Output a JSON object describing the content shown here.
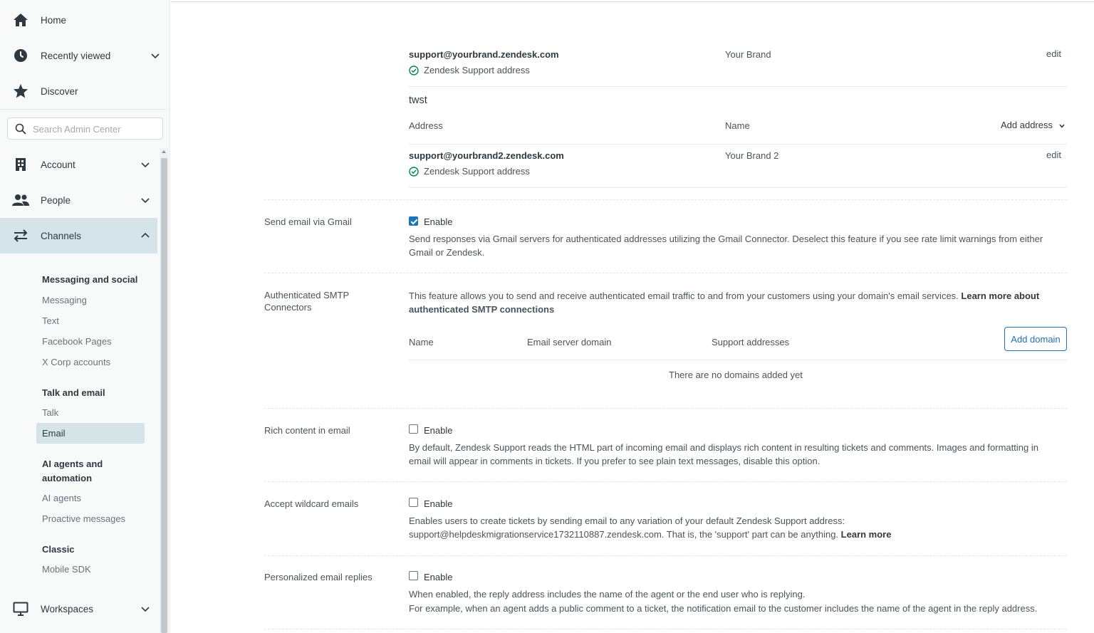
{
  "sidebar": {
    "top_items": [
      {
        "label": "Home",
        "icon": "home-icon"
      },
      {
        "label": "Recently viewed",
        "icon": "clock-icon"
      },
      {
        "label": "Discover",
        "icon": "star-icon"
      }
    ],
    "search_placeholder": "Search Admin Center",
    "sections": [
      {
        "label": "Account",
        "icon": "building-icon"
      },
      {
        "label": "People",
        "icon": "people-icon"
      },
      {
        "label": "Channels",
        "icon": "arrows-icon"
      },
      {
        "label": "Workspaces",
        "icon": "monitor-icon"
      }
    ],
    "channels_groups": [
      {
        "heading": "Messaging and social",
        "items": [
          "Messaging",
          "Text",
          "Facebook Pages",
          "X Corp accounts"
        ]
      },
      {
        "heading": "Talk and email",
        "items": [
          "Talk",
          "Email"
        ]
      },
      {
        "heading": "AI agents and automation",
        "items": [
          "AI agents",
          "Proactive messages"
        ]
      },
      {
        "heading": "Classic",
        "items": [
          "Mobile SDK"
        ]
      }
    ],
    "selected_item": "Email"
  },
  "addresses": {
    "row1": {
      "address": "support@yourbrand.zendesk.com",
      "subtitle": "Zendesk Support address",
      "name": "Your Brand",
      "action": "edit"
    },
    "brand_heading": "twst",
    "col_address": "Address",
    "col_name": "Name",
    "add_address": "Add address",
    "row2": {
      "address": "support@yourbrand2.zendesk.com",
      "subtitle": "Zendesk Support address",
      "name": "Your Brand 2",
      "action": "edit"
    }
  },
  "settings": {
    "gmail": {
      "label": "Send email via Gmail",
      "enable": "Enable",
      "checked": true,
      "desc_line1": "Send responses via Gmail servers for authenticated addresses utilizing the Gmail Connector. Deselect this feature if you see rate limit warnings from either",
      "desc_line2": "Gmail or Zendesk."
    },
    "smtp": {
      "label_line1": "Authenticated SMTP",
      "label_line2": "Connectors",
      "desc_line1": "This feature allows you to send and receive authenticated email traffic to and from your customers using your domain's email services.",
      "learn_more_1": "Learn more about",
      "learn_more_2": "authenticated SMTP connections",
      "col_name": "Name",
      "col_domain": "Email server domain",
      "col_support": "Support addresses",
      "add_domain": "Add domain",
      "empty": "There are no domains added yet"
    },
    "rich": {
      "label": "Rich content in email",
      "enable": "Enable",
      "checked": false,
      "desc_line1": "By default, Zendesk Support reads the HTML part of incoming email and displays rich content in resulting tickets and comments. Images and formatting in",
      "desc_line2": "email will appear in comments in tickets. If you prefer to see plain text messages, disable this option."
    },
    "wildcard": {
      "label": "Accept wildcard emails",
      "enable": "Enable",
      "checked": false,
      "desc_line1": "Enables users to create tickets by sending email to any variation of your default Zendesk Support address:",
      "desc_line2": "support@helpdeskmigrationservice1732110887.zendesk.com. That is, the 'support' part can be anything.",
      "learn_more": "Learn more"
    },
    "personalized": {
      "label": "Personalized email replies",
      "enable": "Enable",
      "checked": false,
      "desc_line1": "When enabled, the reply address includes the name of the agent or the end user who is replying.",
      "desc_line2": "For example, when an agent adds a public comment to a ticket, the notification email to the customer includes the name of the agent in the reply address."
    }
  },
  "colors": {
    "accent": "#1f73b7",
    "success": "#038153",
    "active_bg": "#d4e4e8"
  }
}
